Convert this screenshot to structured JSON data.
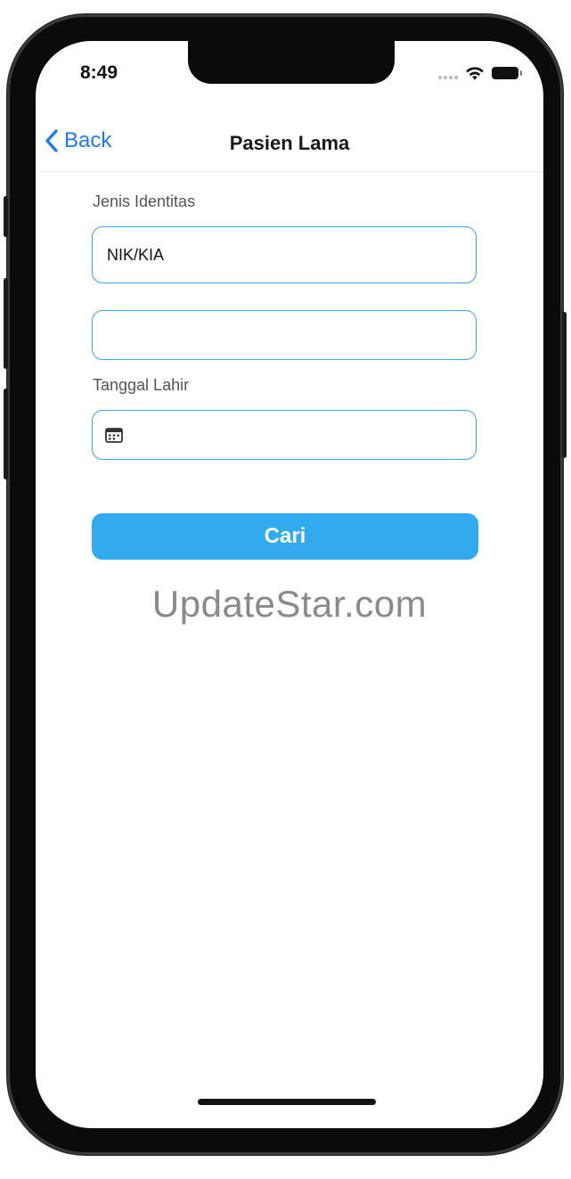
{
  "status_bar": {
    "time": "8:49"
  },
  "nav": {
    "back_label": "Back",
    "title": "Pasien Lama"
  },
  "form": {
    "identity_type_label": "Jenis Identitas",
    "identity_type_value": "NIK/KIA",
    "identity_number_value": "",
    "birth_date_label": "Tanggal Lahir",
    "birth_date_value": "",
    "search_button_label": "Cari"
  },
  "watermark": "UpdateStar.com",
  "colors": {
    "accent": "#31aaee",
    "field_border": "#3aa6e8",
    "back_link": "#1f7bf0"
  },
  "icons": {
    "back": "chevron-left-icon",
    "calendar": "calendar-icon",
    "wifi": "wifi-icon",
    "battery": "battery-icon",
    "signal": "signal-icon"
  }
}
